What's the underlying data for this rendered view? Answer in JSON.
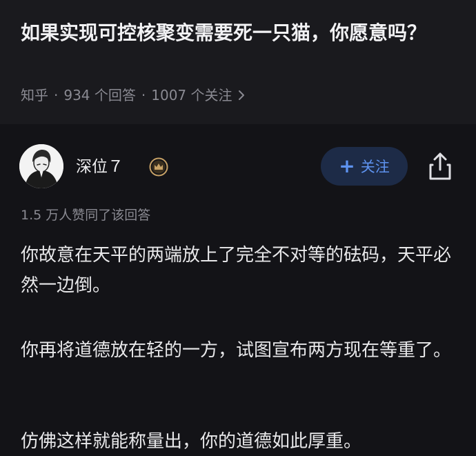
{
  "question": {
    "title": "如果实现可控核聚变需要死一只猫，你愿意吗？",
    "source": "知乎",
    "answers": "934 个回答",
    "followers": "1007 个关注",
    "separator": "·"
  },
  "answer": {
    "author": "深位７",
    "badge_icon": "crown-badge-icon",
    "follow_label": "关注",
    "upvotes": "1.5 万人赞同了该回答",
    "paragraphs": [
      "你故意在天平的两端放上了完全不对等的砝码，天平必然一边倒。",
      "你再将道德放在轻的一方，试图宣布两方现在等重了。",
      "仿佛这样就能称量出，你的道德如此厚重。"
    ]
  },
  "colors": {
    "background": "#131317",
    "header_background": "#1a1a1e",
    "accent": "#5e93f0",
    "follow_button_bg": "#1d2b47",
    "badge_gold": "#c8a266",
    "muted_text": "#8a8a92"
  }
}
